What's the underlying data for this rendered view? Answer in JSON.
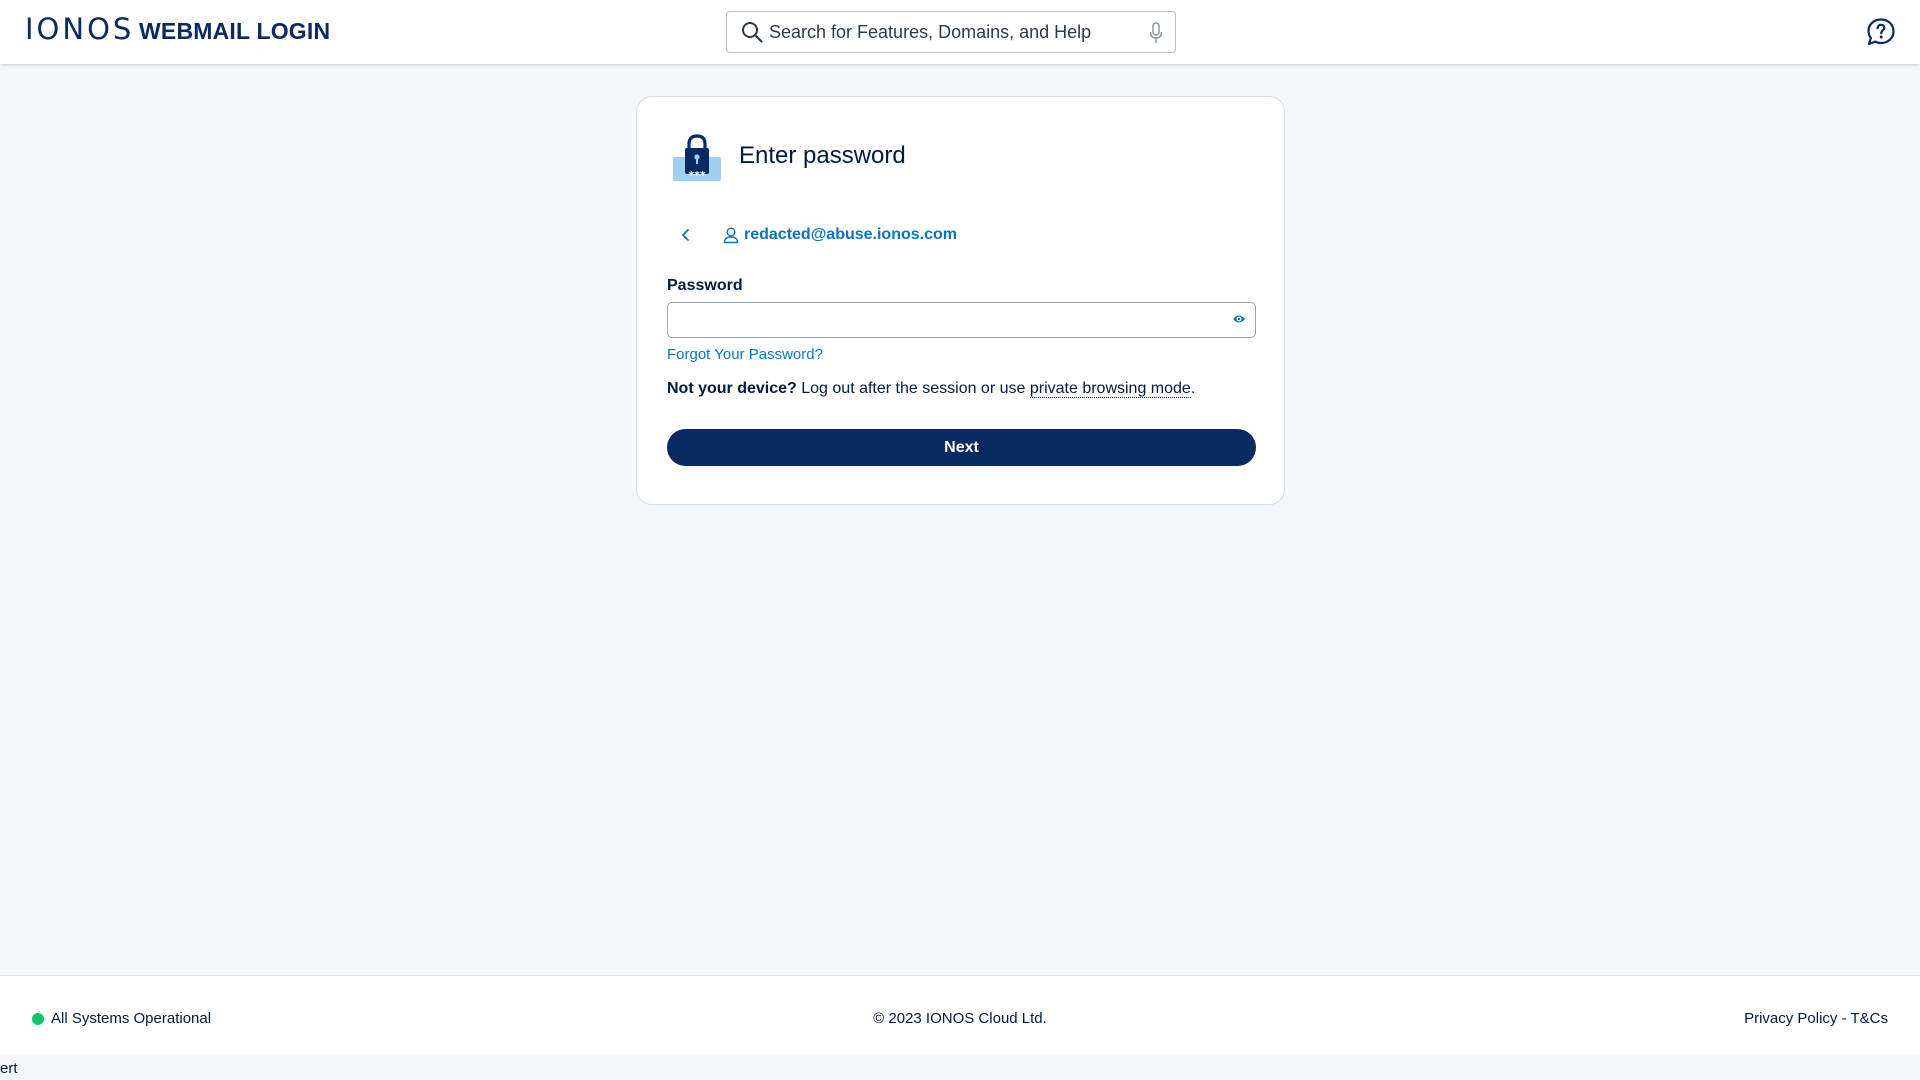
{
  "header": {
    "logo": "IONOS",
    "title": "WEBMAIL LOGIN",
    "search_placeholder": "Search for Features, Domains, and Help"
  },
  "card": {
    "title": "Enter password",
    "email": "redacted@abuse.ionos.com",
    "password_label": "Password",
    "password_value": "",
    "forgot_link": "Forgot Your Password?",
    "notice_bold": "Not your device?",
    "notice_text": " Log out after the session or use ",
    "notice_link": "private browsing mode",
    "notice_end": ".",
    "next_label": "Next"
  },
  "footer": {
    "status": "All Systems Operational",
    "copyright": "© 2023 IONOS Cloud Ltd.",
    "privacy": "Privacy Policy",
    "separator": " - ",
    "terms": "T&Cs"
  },
  "stray_text": "ert",
  "colors": {
    "brand_navy": "#0b2a63",
    "link_blue": "#0b74c2",
    "status_green": "#12c46b",
    "background": "#f4f7fa"
  },
  "icons": {
    "search": "search-icon",
    "mic": "microphone-icon",
    "help": "help-chat-icon",
    "lock": "padlock-password-icon",
    "back": "chevron-left-icon",
    "user": "user-icon",
    "eye": "eye-icon"
  }
}
